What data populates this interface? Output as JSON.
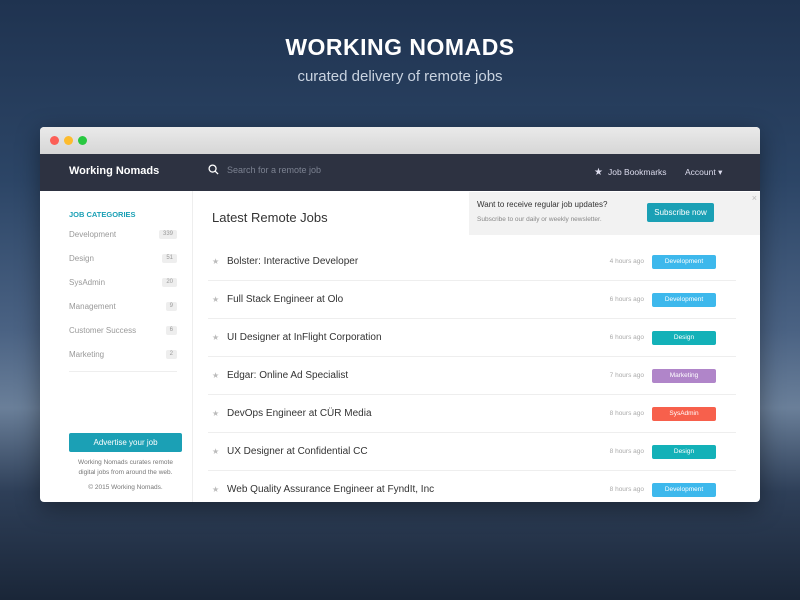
{
  "hero": {
    "title": "WORKING NOMADS",
    "subtitle": "curated delivery of remote jobs"
  },
  "nav": {
    "brand": "Working Nomads",
    "search_placeholder": "Search for a remote job",
    "bookmarks": "Job Bookmarks",
    "account": "Account ▾"
  },
  "sidebar": {
    "heading": "JOB CATEGORIES",
    "categories": [
      {
        "label": "Development",
        "count": "339"
      },
      {
        "label": "Design",
        "count": "51"
      },
      {
        "label": "SysAdmin",
        "count": "20"
      },
      {
        "label": "Management",
        "count": "9"
      },
      {
        "label": "Customer Success",
        "count": "6"
      },
      {
        "label": "Marketing",
        "count": "2"
      }
    ],
    "advertise": "Advertise your job",
    "about": "Working Nomads curates remote digital jobs from around the web.",
    "copyright": "© 2015 Working Nomads."
  },
  "main": {
    "heading": "Latest Remote Jobs",
    "promo": {
      "title": "Want to receive regular job updates?",
      "subtitle": "Subscribe to our daily or weekly newsletter.",
      "button": "Subscribe now",
      "close": "×"
    },
    "jobs": [
      {
        "title": "Bolster: Interactive Developer",
        "time": "4 hours ago",
        "tag": "Development"
      },
      {
        "title": "Full Stack Engineer at Olo",
        "time": "6 hours ago",
        "tag": "Development"
      },
      {
        "title": "UI Designer at InFlight Corporation",
        "time": "6 hours ago",
        "tag": "Design"
      },
      {
        "title": "Edgar: Online Ad Specialist",
        "time": "7 hours ago",
        "tag": "Marketing"
      },
      {
        "title": "DevOps Engineer at CÜR Media",
        "time": "8 hours ago",
        "tag": "SysAdmin"
      },
      {
        "title": "UX Designer at Confidential CC",
        "time": "8 hours ago",
        "tag": "Design"
      },
      {
        "title": "Web Quality Assurance Engineer at FyndIt, Inc",
        "time": "8 hours ago",
        "tag": "Development"
      }
    ]
  },
  "colors": {
    "accent": "#1ba0b5",
    "Development": "#3db8ec",
    "Design": "#13b1b8",
    "Marketing": "#b085c9",
    "SysAdmin": "#f7604c",
    "nav": "#2d3241"
  }
}
